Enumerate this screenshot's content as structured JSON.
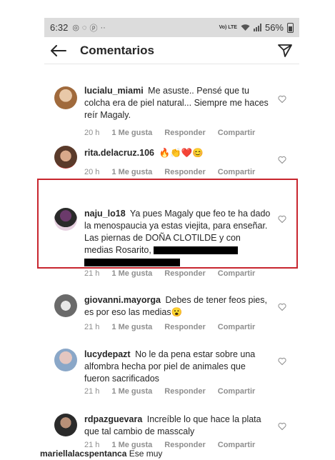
{
  "status": {
    "time": "6:32",
    "battery": "56%",
    "network": "Vo) LTE"
  },
  "header": {
    "title": "Comentarios",
    "back_icon": "arrow-left-icon",
    "share_icon": "paper-plane-icon"
  },
  "meta_labels": {
    "likes": "1 Me gusta",
    "reply": "Responder",
    "share": "Compartir"
  },
  "comments": [
    {
      "username": "lucialu_miami",
      "text": "Me asuste.. Pensé que tu colcha era de piel natural... Siempre me haces reír Magaly.",
      "time": "20 h",
      "likes": "1 Me gusta",
      "reply": "Responder",
      "share": "Compartir"
    },
    {
      "username": "rita.delacruz.106",
      "text": "🔥👏❤️😊",
      "time": "20 h",
      "likes": "1 Me gusta",
      "reply": "Responder",
      "share": "Compartir"
    },
    {
      "username": "naju_lo18",
      "text": "Ya pues Magaly que feo te ha dado la menospaucia ya estas viejita, para enseñar. Las piernas de DOÑA  CLOTILDE y con medias Rosarito,",
      "time": "21 h",
      "likes": "1 Me gusta",
      "reply": "Responder",
      "share": "Compartir"
    },
    {
      "username": "giovanni.mayorga",
      "text": "Debes de tener feos pies, es por eso las medias😮",
      "time": "21 h",
      "likes": "1 Me gusta",
      "reply": "Responder",
      "share": "Compartir"
    },
    {
      "username": "lucydepazt",
      "text": "No le da pena estar sobre una alfombra hecha por piel de animales que fueron sacrificados",
      "time": "21 h",
      "likes": "1 Me gusta",
      "reply": "Responder",
      "share": "Compartir"
    },
    {
      "username": "rdpazguevara",
      "text": "Increíble lo que hace la plata que tal cambio de masscaly",
      "time": "21 h",
      "likes": "1 Me gusta",
      "reply": "Responder",
      "share": "Compartir"
    }
  ],
  "partial_comment": {
    "username": "mariellalacspentanca",
    "text": "Ese muy"
  },
  "colors": {
    "highlight": "#c8262e",
    "meta": "#8e8e8e",
    "text": "#262626"
  }
}
